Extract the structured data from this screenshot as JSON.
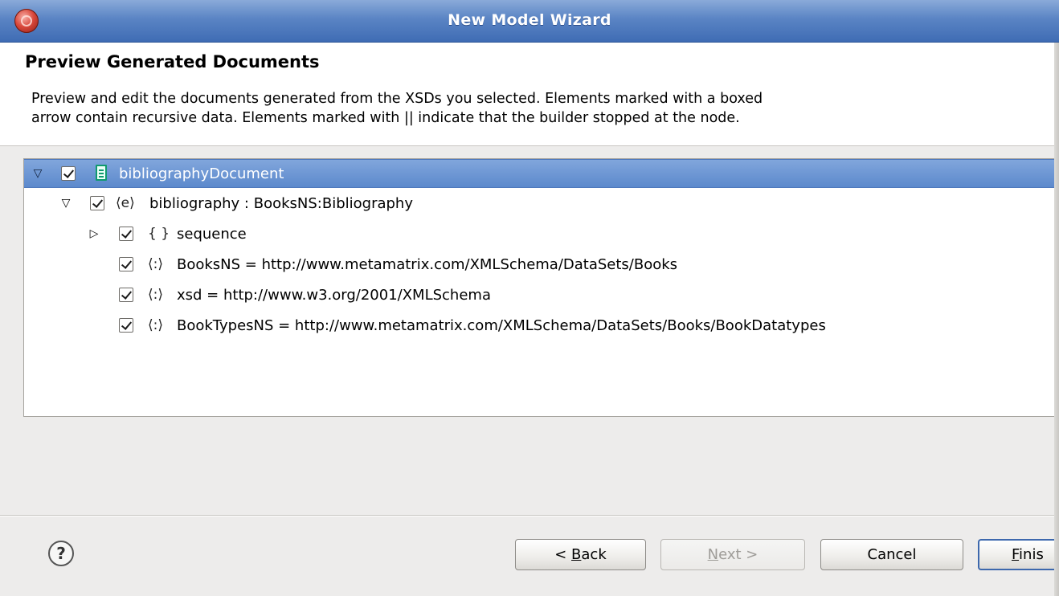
{
  "window": {
    "title": "New Model Wizard"
  },
  "header": {
    "title": "Preview Generated Documents",
    "description_line1": "Preview and edit the documents generated from the XSDs you selected.  Elements marked with a boxed",
    "description_line2": "arrow contain recursive data.  Elements marked with || indicate that the builder stopped at the node."
  },
  "tree": {
    "rows": [
      {
        "label": "bibliographyDocument",
        "icon": "document-icon",
        "expander": "expanded",
        "checked": true,
        "selected": true
      },
      {
        "label": "bibliography : BooksNS:Bibliography",
        "icon": "element-icon",
        "icon_glyph": "⟨e⟩",
        "expander": "expanded",
        "checked": true
      },
      {
        "label": "sequence",
        "icon": "sequence-icon",
        "icon_glyph": "{ }",
        "expander": "collapsed",
        "checked": true
      },
      {
        "label": "BooksNS = http://www.metamatrix.com/XMLSchema/DataSets/Books",
        "icon": "namespace-icon",
        "icon_glyph": "⟨:⟩",
        "checked": true
      },
      {
        "label": "xsd = http://www.w3.org/2001/XMLSchema",
        "icon": "namespace-icon",
        "icon_glyph": "⟨:⟩",
        "checked": true
      },
      {
        "label": "BookTypesNS = http://www.metamatrix.com/XMLSchema/DataSets/Books/BookDatatypes",
        "icon": "namespace-icon",
        "icon_glyph": "⟨:⟩",
        "checked": true
      }
    ]
  },
  "footer": {
    "help_label": "?",
    "back_pre": "< ",
    "back_mn": "B",
    "back_post": "ack",
    "next_mn": "N",
    "next_post": "ext >",
    "cancel_label": "Cancel",
    "finish_mn": "F",
    "finish_post": "inis"
  },
  "colors": {
    "titlebar": "#5a84c4",
    "selection": "#6b94d2",
    "document_icon": "#0f9a6e"
  }
}
